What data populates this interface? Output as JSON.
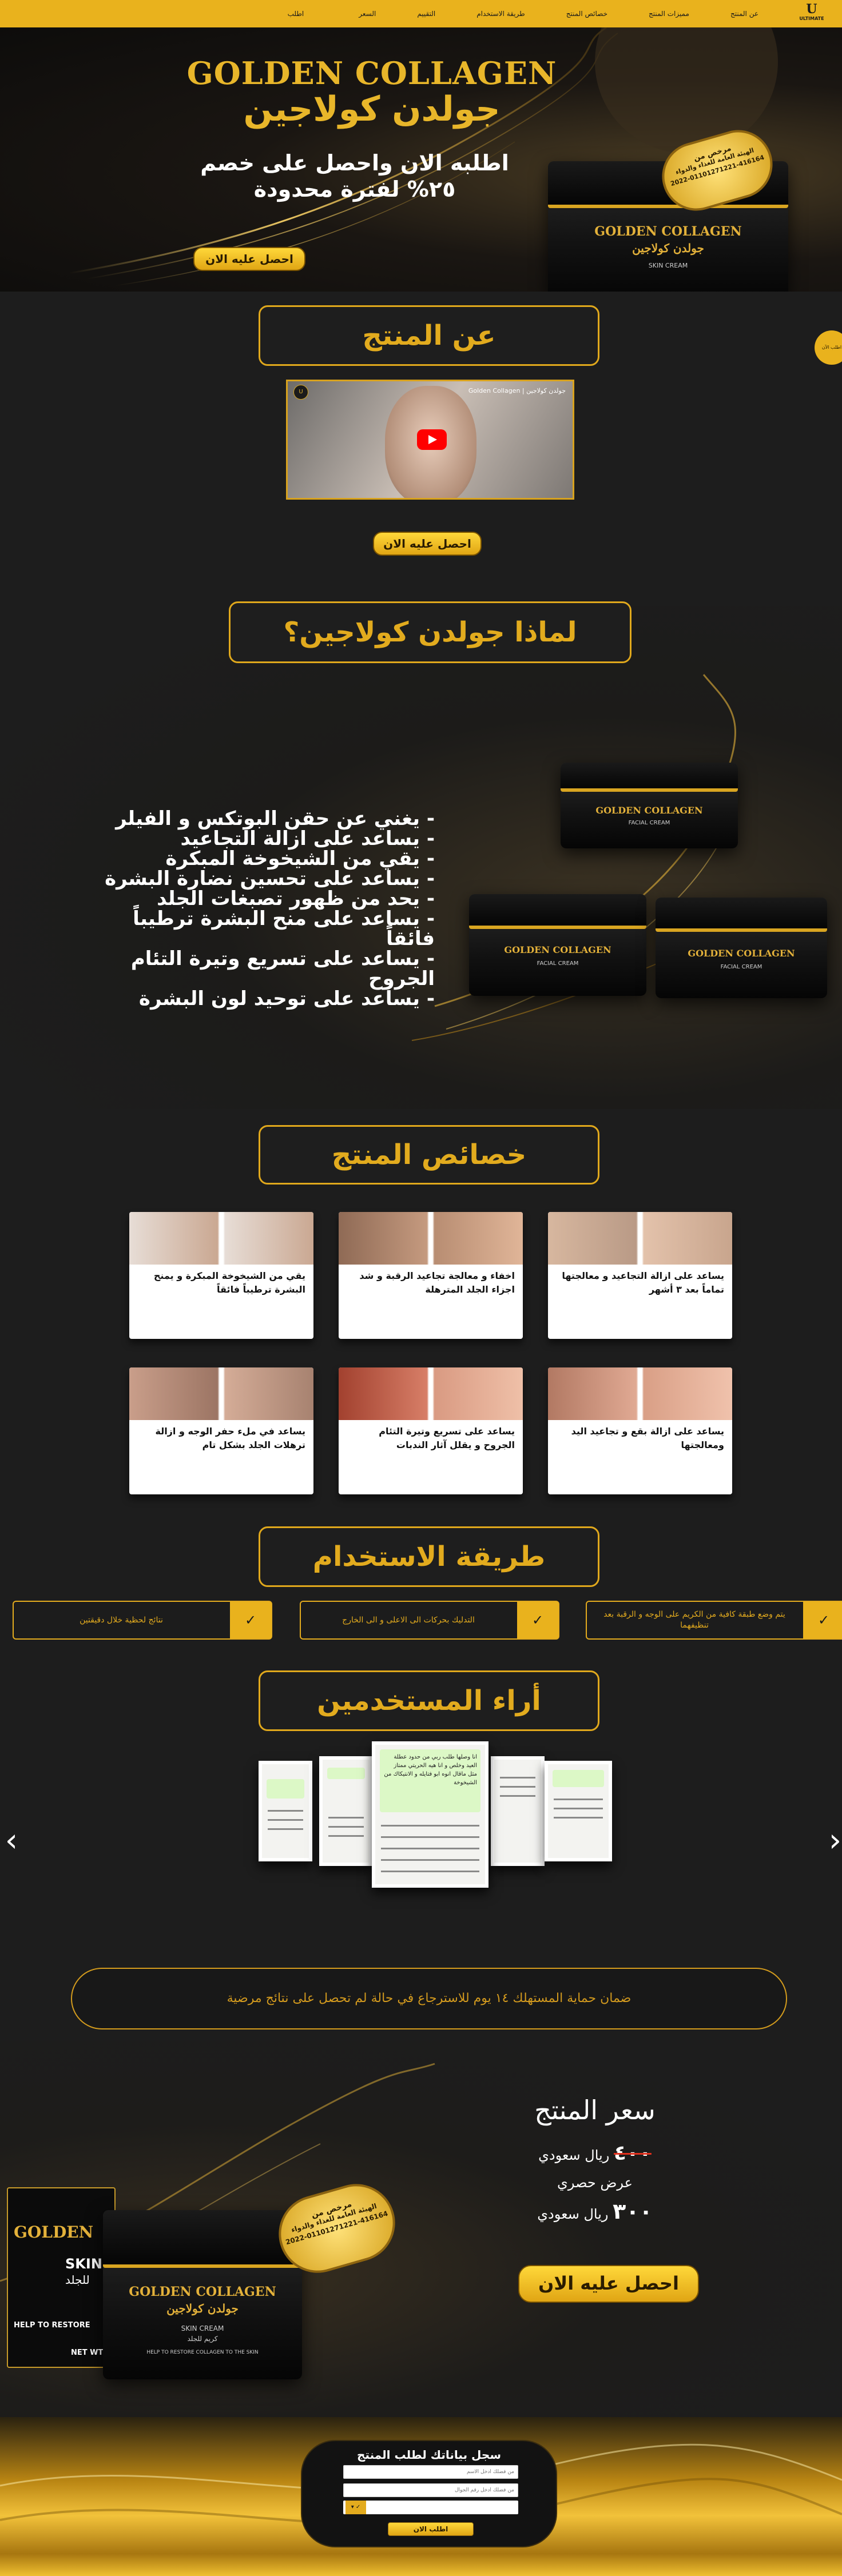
{
  "navbar": {
    "logo_mark": "U",
    "logo_text": "ULTIMATE",
    "links": [
      "عن المنتج",
      "مميزات المنتج",
      "خصائص المنتج",
      "طريقة الاستخدام",
      "التقييم",
      "السعر",
      "اطلب"
    ]
  },
  "hero": {
    "title_en": "GOLDEN COLLAGEN",
    "title_ar": "جولدن كولاجين",
    "offer_line1": "اطلبه الان واحصل على خصم",
    "offer_line2": "٢٥% لفترة محدودة",
    "cta": "احصل عليه الان",
    "jar_en": "GOLDEN COLLAGEN",
    "jar_ar": "جولدن كولاجين",
    "jar_sub": "SKIN CREAM",
    "badge_line1": "مرخص من",
    "badge_line2": "الهيئة العامة للغذاء والدواء",
    "badge_number": "2022-01101271221-416164"
  },
  "side_tab": "اطلب الآن",
  "about": {
    "title": "عن المنتج",
    "video_title": "جولدن كولاجين | Golden Collagen",
    "video_channel_icon": "U",
    "cta": "احصل عليه الان"
  },
  "why": {
    "title": "لماذا جولدن كولاجين؟",
    "items": [
      "- يغني عن حقن البوتكس و الفيلر",
      "- يساعد على ازالة التجاعيد",
      "- يقي من الشيخوخة المبكرة",
      "- يساعد على تحسين نضارة البشرة",
      "- يحد من ظهور تصبغات الجلد",
      "- يساعد على منح البشرة ترطيباً فائقاً",
      "- يساعد على تسريع وتيرة التئام الجروح",
      "- يساعد على توحيد لون البشرة"
    ],
    "jar_label": "GOLDEN COLLAGEN",
    "jar_sub": "FACIAL CREAM"
  },
  "features": {
    "title": "خصائص المنتج",
    "cards": [
      "يساعد على ازالة التجاعيد و معالجتها تماماً بعد ٣ أشهر",
      "اخفاء و معالجة تجاعيد الرقبة و شد اجزاء الجلد المترهلة",
      "يقي من الشيخوخة المبكرة و يمنح البشرة ترطيباً فائقاً",
      "يساعد على ازالة بقع و تجاعيد اليد ومعالجتها",
      "يساعد على تسريع وتيرة التئام الجروح و يقلل آثار الندبات",
      "يساعد في ملء حفر الوجه و ازالة ترهلات الجلد بشكل تام"
    ]
  },
  "usage": {
    "title": "طريقة الاستخدام",
    "steps": [
      "يتم وضع طبقة كافية من الكريم على الوجه و الرقبة بعد تنظيفهما",
      "التدليك بحركات الى الاعلى و الى الخارج",
      "نتائج لحظية خلال دقيقتين"
    ],
    "check_icon": "✓"
  },
  "reviews": {
    "title": "أراء المستخدمين",
    "center_text": "انا وصلها طلب ربي من حدود عطلة العيد وخلص و انا هيه الحريتي ممتاز مثل ماقال انوه ابو فتايله و الانتيكاك من الشيخوخة",
    "prev": "‹",
    "next": "›"
  },
  "guarantee": "ضمان حماية المستهلك ١٤ يوم للاسترجاع في حالة لم تحصل على نتائج مرضية",
  "pricing": {
    "title": "سعر المنتج",
    "old_price": "٤٠٠",
    "old_currency": "ريال سعودي",
    "special": "عرض حصري",
    "new_price": "٣٠٠",
    "new_currency": "ريال سعودي",
    "cta": "احصل عليه الان",
    "box_brand": "GOLDEN",
    "box_skin": "SKIN",
    "box_skin_ar": "للجلد",
    "box_help": "HELP TO RESTORE",
    "box_net": "NET WT",
    "jar_en": "GOLDEN COLLAGEN",
    "jar_ar": "جولدن كولاجين",
    "jar_sub": "SKIN CREAM",
    "jar_sub_ar": "كريم للجلد",
    "jar_help": "HELP TO RESTORE COLLAGEN TO THE SKIN",
    "badge_line1": "مرخص من",
    "badge_line2": "الهيئة العامة للغذاء والدواء",
    "badge_number": "2022-01101271221-416164"
  },
  "form": {
    "title": "سجل بياناتك لطلب المنتج",
    "name_placeholder": "من فضلك ادخل الاسم",
    "phone_placeholder": "من فضلك ادخل رقم الجوال",
    "select_value": "",
    "submit": "اطلب الان"
  },
  "colors": {
    "gold": "#e9b21d",
    "background": "#1d1d1d",
    "accent_text": "#e2ab1e"
  }
}
